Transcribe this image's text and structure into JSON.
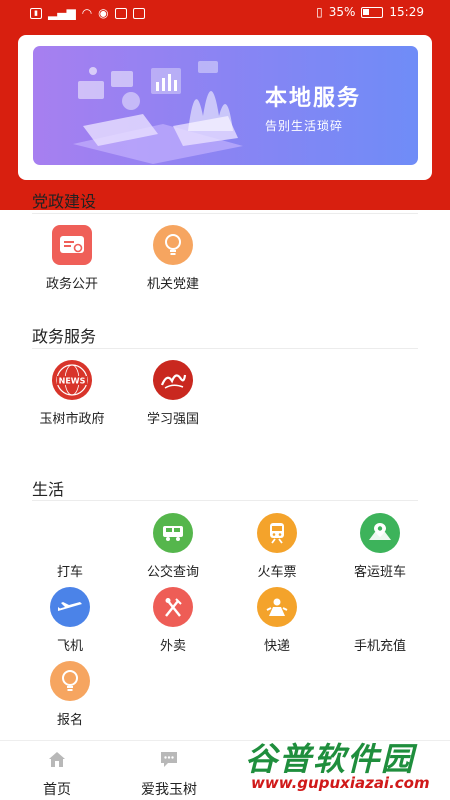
{
  "status_bar": {
    "left_icons": [
      "sim-icon",
      "sim2-icon",
      "wifi-icon",
      "eye-icon",
      "location-icon",
      "app-icon"
    ],
    "battery_percent": "35%",
    "time": "15:29"
  },
  "banner": {
    "title": "本地服务",
    "subtitle": "告别生活琐碎"
  },
  "sections": {
    "party": {
      "title": "党政建设",
      "items": [
        {
          "label": "政务公开",
          "icon": "document-search-icon",
          "color": "#ee5d56"
        },
        {
          "label": "机关党建",
          "icon": "lightbulb-icon",
          "color": "#f6a560"
        }
      ]
    },
    "gov": {
      "title": "政务服务",
      "items": [
        {
          "label": "玉树市政府",
          "icon": "news-globe-icon",
          "color": "#d8342a"
        },
        {
          "label": "学习强国",
          "icon": "xuexi-logo-icon",
          "color": "#c9281f"
        }
      ]
    },
    "life": {
      "title": "生活",
      "items": [
        {
          "label": "打车",
          "icon": "taxi-icon",
          "color": "#ffffff"
        },
        {
          "label": "公交查询",
          "icon": "bus-icon",
          "color": "#55b64c"
        },
        {
          "label": "火车票",
          "icon": "train-icon",
          "color": "#f4a32b"
        },
        {
          "label": "客运班车",
          "icon": "map-pin-icon",
          "color": "#3db35b"
        },
        {
          "label": "飞机",
          "icon": "plane-icon",
          "color": "#4b83e8"
        },
        {
          "label": "外卖",
          "icon": "fork-knife-icon",
          "color": "#ee5d56"
        },
        {
          "label": "快递",
          "icon": "courier-icon",
          "color": "#f4a32b"
        },
        {
          "label": "手机充值",
          "icon": "phone-topup-icon",
          "color": "#ffffff"
        },
        {
          "label": "报名",
          "icon": "lightbulb-icon",
          "color": "#f6a560"
        }
      ]
    }
  },
  "bottom_nav": {
    "tabs": [
      {
        "label": "首页",
        "icon": "home-icon"
      },
      {
        "label": "爱我玉树",
        "icon": "chat-icon"
      }
    ]
  },
  "watermark": {
    "title": "谷普软件园",
    "url": "www.gupuxiazai.com"
  }
}
